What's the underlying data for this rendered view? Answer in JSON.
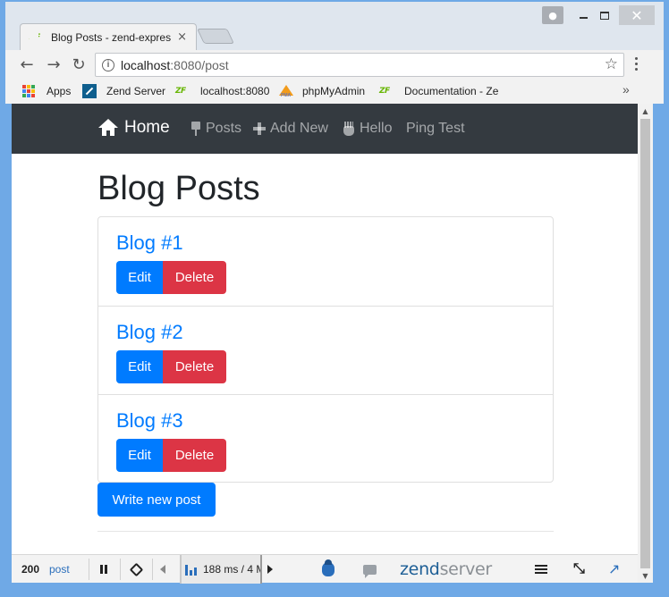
{
  "browser": {
    "tab_title": "Blog Posts - zend-expres",
    "address": {
      "host": "localhost",
      "rest": ":8080/post"
    },
    "bookmarks": [
      {
        "label": "Apps"
      },
      {
        "label": "Zend Server"
      },
      {
        "label": "localhost:8080"
      },
      {
        "label": "phpMyAdmin"
      },
      {
        "label": "Documentation - Ze"
      }
    ],
    "bookmarks_more": "»",
    "tab_close": "×",
    "win_close": "✕",
    "zf_logo_text": "ZF",
    "pma_logo_text": "PMA"
  },
  "navbar": {
    "brand": "Home",
    "links": [
      {
        "label": "Posts",
        "icon": "pin-icon"
      },
      {
        "label": "Add New",
        "icon": "plus-icon"
      },
      {
        "label": "Hello",
        "icon": "hand-icon"
      },
      {
        "label": "Ping Test",
        "icon": ""
      }
    ]
  },
  "page": {
    "title": "Blog Posts",
    "posts": [
      {
        "title": "Blog #1",
        "edit": "Edit",
        "delete": "Delete"
      },
      {
        "title": "Blog #2",
        "edit": "Edit",
        "delete": "Delete"
      },
      {
        "title": "Blog #3",
        "edit": "Edit",
        "delete": "Delete"
      }
    ],
    "write_button": "Write new post"
  },
  "zendbar": {
    "status_code": "200",
    "path": "post",
    "metric": "188 ms / 4 M",
    "logo_main": "zend",
    "logo_sub": "server"
  },
  "colors": {
    "navbar_bg": "#343a40",
    "primary": "#007bff",
    "danger": "#dc3545",
    "window_frame": "#6fa9e6"
  }
}
